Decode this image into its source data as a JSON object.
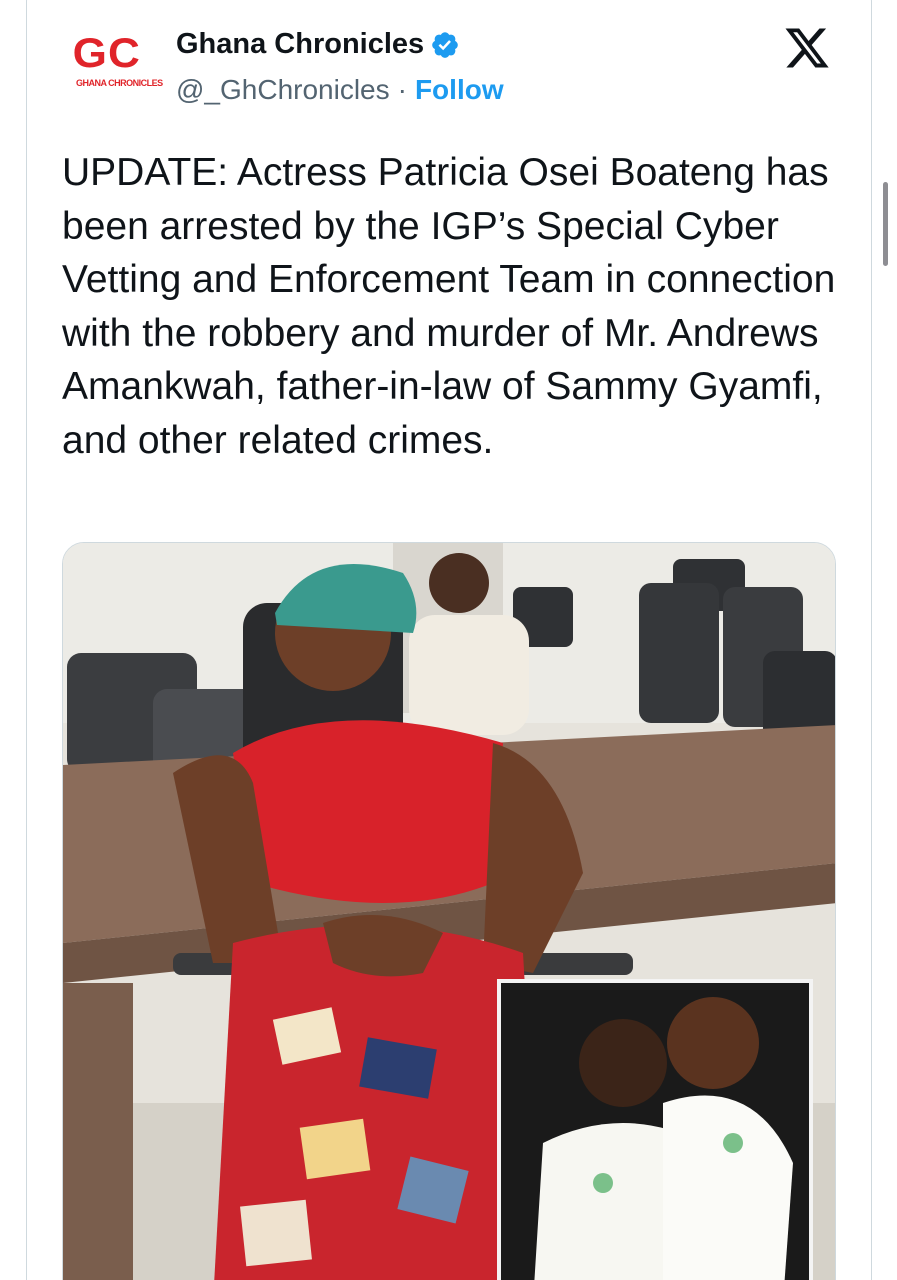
{
  "author": {
    "display_name": "Ghana Chronicles",
    "handle": "@_GhChronicles",
    "separator": "·",
    "follow_label": "Follow",
    "avatar_logo_text": "GC",
    "avatar_logo_subtext": "GHANA CHRONICLES",
    "verified": true
  },
  "tweet": {
    "text": "UPDATE: Actress Patricia Osei Boateng has been arrested by the IGP’s Special Cyber Vetting and Enforcement Team in connection with the robbery and murder of Mr. Andrews Amankwah, father-in-law of Sammy Gyamfi, and other related crimes."
  },
  "icons": {
    "verified": "verified-badge-icon",
    "platform": "x-logo-icon"
  },
  "colors": {
    "follow": "#1d9bf0",
    "verified": "#1d9bf0",
    "brand_red": "#e0242a",
    "secondary_text": "#536471",
    "border": "#cfd9de"
  }
}
